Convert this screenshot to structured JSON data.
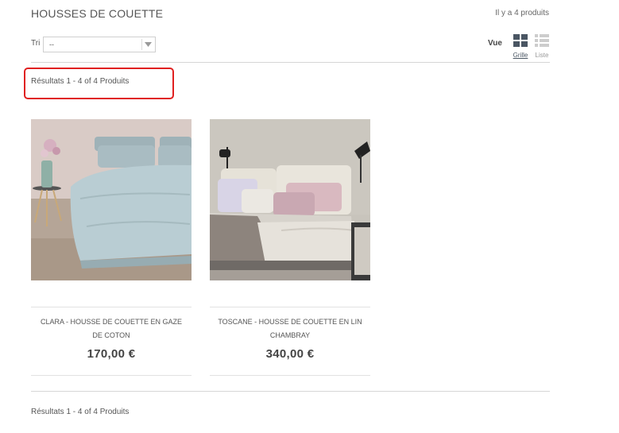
{
  "header": {
    "title": "HOUSSES DE COUETTE",
    "product_count": "Il y a 4 produits"
  },
  "toolbar": {
    "sort_label": "Tri",
    "sort_value": "--",
    "view_label": "Vue",
    "grid_label": "Grille",
    "list_label": "Liste"
  },
  "results": {
    "top": "Résultats 1 - 4 of 4 Produits",
    "bottom": "Résultats 1 - 4 of 4 Produits"
  },
  "products": [
    {
      "name": "CLARA - HOUSSE DE COUETTE EN GAZE DE COTON",
      "price": "170,00 €"
    },
    {
      "name": "TOSCANE - HOUSSE DE COUETTE EN LIN CHAMBRAY",
      "price": "340,00 €"
    }
  ],
  "colors": {
    "highlight": "#e02020",
    "grid_icon_active": "#4a5663",
    "list_icon_inactive": "#c9c9c9"
  }
}
